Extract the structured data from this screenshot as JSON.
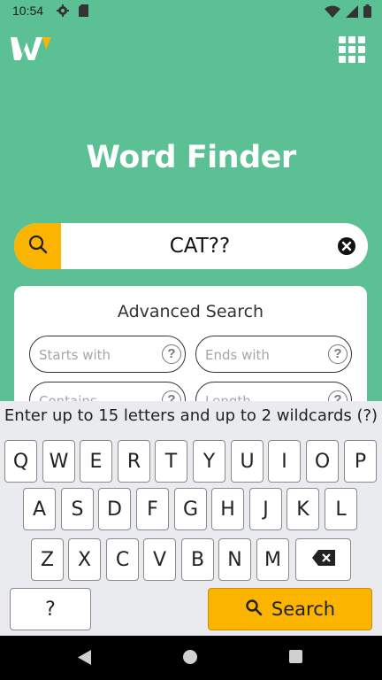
{
  "status_bar": {
    "time": "10:54",
    "icons": [
      "gear-icon",
      "sd-card-icon",
      "wifi-icon",
      "signal-icon",
      "battery-icon"
    ]
  },
  "header": {
    "logo": "word-finder-logo",
    "menu_icon": "grid-menu-icon"
  },
  "title": "Word Finder",
  "search": {
    "value": "CAT??",
    "search_icon": "search-icon",
    "clear_icon": "close-circle-icon"
  },
  "advanced": {
    "title": "Advanced Search",
    "fields": [
      {
        "placeholder": "Starts with",
        "help": "?"
      },
      {
        "placeholder": "Ends with",
        "help": "?"
      },
      {
        "placeholder": "Contains",
        "help": "?"
      },
      {
        "placeholder": "Length",
        "help": "?"
      }
    ]
  },
  "keyboard": {
    "hint": "Enter up to 15 letters and up to 2 wildcards (?)",
    "row1": [
      "Q",
      "W",
      "E",
      "R",
      "T",
      "Y",
      "U",
      "I",
      "O",
      "P"
    ],
    "row2": [
      "A",
      "S",
      "D",
      "F",
      "G",
      "H",
      "J",
      "K",
      "L"
    ],
    "row3": [
      "Z",
      "X",
      "C",
      "V",
      "B",
      "N",
      "M"
    ],
    "wildcard_key": "?",
    "search_key": "Search",
    "backspace_icon": "backspace-icon"
  },
  "nav_bar": {
    "icons": [
      "back-icon",
      "home-icon",
      "recents-icon"
    ]
  },
  "colors": {
    "background": "#5cc095",
    "accent": "#fbb400",
    "keyboard": "#e9ebee"
  }
}
